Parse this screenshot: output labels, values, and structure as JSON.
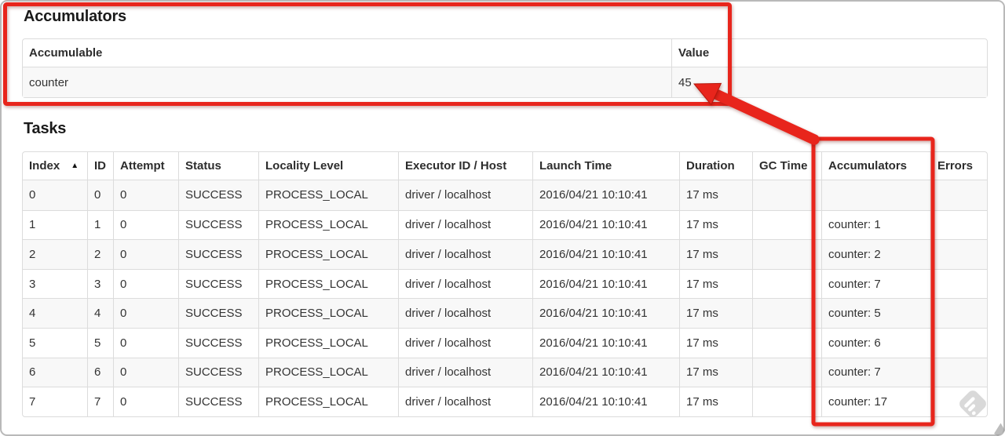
{
  "accumulators_section": {
    "title": "Accumulators",
    "table": {
      "headers": [
        "Accumulable",
        "Value"
      ],
      "rows": [
        [
          "counter",
          "45"
        ]
      ]
    }
  },
  "tasks_section": {
    "title": "Tasks",
    "table": {
      "sort_icon": "▲",
      "headers": [
        "Index",
        "ID",
        "Attempt",
        "Status",
        "Locality Level",
        "Executor ID / Host",
        "Launch Time",
        "Duration",
        "GC Time",
        "Accumulators",
        "Errors"
      ],
      "rows": [
        [
          "0",
          "0",
          "0",
          "SUCCESS",
          "PROCESS_LOCAL",
          "driver / localhost",
          "2016/04/21 10:10:41",
          "17 ms",
          "",
          "",
          ""
        ],
        [
          "1",
          "1",
          "0",
          "SUCCESS",
          "PROCESS_LOCAL",
          "driver / localhost",
          "2016/04/21 10:10:41",
          "17 ms",
          "",
          "counter: 1",
          ""
        ],
        [
          "2",
          "2",
          "0",
          "SUCCESS",
          "PROCESS_LOCAL",
          "driver / localhost",
          "2016/04/21 10:10:41",
          "17 ms",
          "",
          "counter: 2",
          ""
        ],
        [
          "3",
          "3",
          "0",
          "SUCCESS",
          "PROCESS_LOCAL",
          "driver / localhost",
          "2016/04/21 10:10:41",
          "17 ms",
          "",
          "counter: 7",
          ""
        ],
        [
          "4",
          "4",
          "0",
          "SUCCESS",
          "PROCESS_LOCAL",
          "driver / localhost",
          "2016/04/21 10:10:41",
          "17 ms",
          "",
          "counter: 5",
          ""
        ],
        [
          "5",
          "5",
          "0",
          "SUCCESS",
          "PROCESS_LOCAL",
          "driver / localhost",
          "2016/04/21 10:10:41",
          "17 ms",
          "",
          "counter: 6",
          ""
        ],
        [
          "6",
          "6",
          "0",
          "SUCCESS",
          "PROCESS_LOCAL",
          "driver / localhost",
          "2016/04/21 10:10:41",
          "17 ms",
          "",
          "counter: 7",
          ""
        ],
        [
          "7",
          "7",
          "0",
          "SUCCESS",
          "PROCESS_LOCAL",
          "driver / localhost",
          "2016/04/21 10:10:41",
          "17 ms",
          "",
          "counter: 17",
          ""
        ]
      ]
    }
  },
  "annotations": {
    "color": "#e8251c"
  },
  "icons": {
    "sort_ascending": "▲",
    "watermark": "screenshot-tool-diamond-badge"
  }
}
